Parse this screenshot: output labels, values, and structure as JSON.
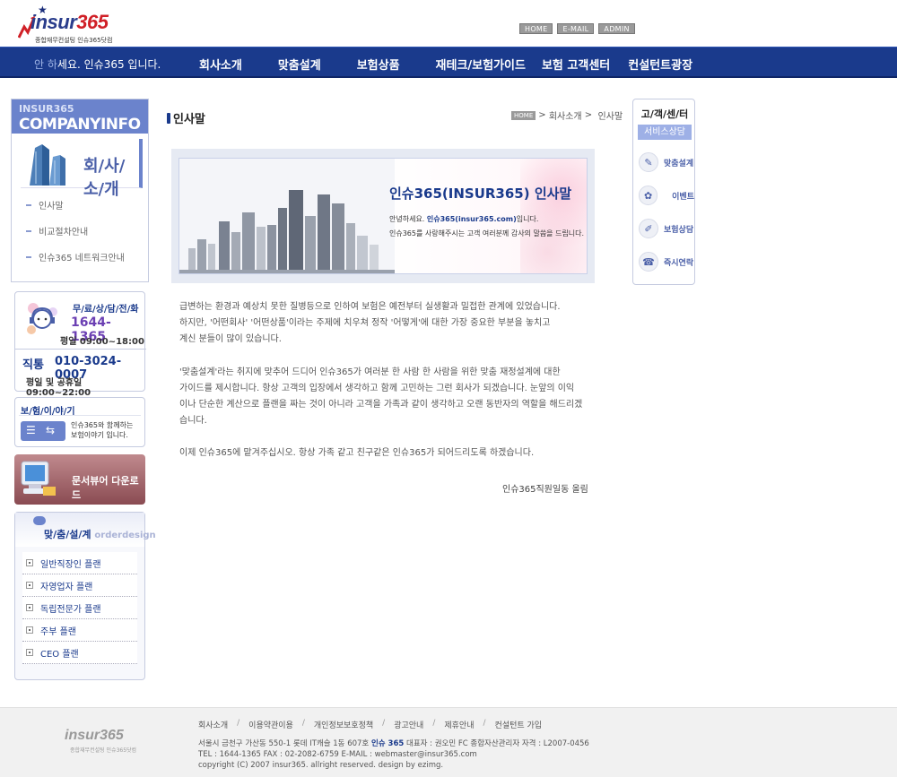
{
  "header": {
    "logo_text_part1": "insur",
    "logo_text_part2": "365",
    "logo_tagline": "종합재무컨설팅 인슈365닷컴",
    "top_buttons": [
      "HOME",
      "E-MAIL",
      "ADMIN"
    ]
  },
  "nav": {
    "greeting_fade": "안 하",
    "greeting": "세요. 인슈365 입니다.",
    "menu": [
      "회사소개",
      "맞춤설계",
      "보험상품",
      "재테크/보험가이드",
      "보험 고객센터",
      "컨설턴트광장"
    ]
  },
  "sidebar": {
    "company_small": "INSUR365",
    "company_big": "COMPANYINFO",
    "company_title": "회/사/소/개",
    "menu": [
      "인사말",
      "비교절차안내",
      "인슈365 네트워크안내"
    ],
    "call": {
      "label": "무/료/상/담/전/화",
      "number": "1644-1365",
      "hours": "평일 09:00~18:00",
      "direct_label": "직통",
      "direct_number": "010-3024-0007",
      "direct_hours": "평일 및 공휴일 09:00~22:00"
    },
    "story": {
      "title": "보/험/이/야/기",
      "text_line1": "인슈365와 함께하는",
      "text_line2": "보험이야기 입니다."
    },
    "viewer_label": "문서뷰어 다운로드",
    "design": {
      "title": "맞/춤/설/계",
      "subtitle": "orderdesign",
      "items": [
        "일반직장인 플랜",
        "자영업자 플랜",
        "독립전문가 플랜",
        "주부 플랜",
        "CEO 플랜"
      ]
    }
  },
  "content": {
    "heading": "인사말",
    "breadcrumb": {
      "home": "HOME",
      "level1": "회사소개",
      "level2": "인사말"
    },
    "banner": {
      "title": "인슈365(INSUR365) 인사말",
      "line1_pre": "안녕하세요. ",
      "line1_bold": "인슈365(insur365.com)",
      "line1_post": "입니다.",
      "line2": "인슈365를 사랑해주시는 고객 여러분께 감사의 말씀을 드립니다."
    },
    "paragraphs": [
      [
        "급변하는 환경과 예상치 못한 질병등으로 인하여 보험은 예전부터 실생활과 밀접한 관계에 있었습니다.",
        "하지만, '어떤회사' '어떤상품'이라는 주제에 치우쳐 정작 '어떻게'에 대한 가장 중요한 부분을 놓치고",
        "계신 분들이 많이 있습니다."
      ],
      [
        "'맞춤설계'라는 취지에 맞추어 드디어 인슈365가 여러분 한 사람 한 사람을 위한 맞춤 재정설계에 대한",
        "가이드를 제시합니다. 항상 고객의 입장에서 생각하고 함께 고민하는 그런 회사가 되겠습니다. 눈앞의 이익",
        "이나 단순한 계산으로 플랜을 짜는 것이 아니라 고객을 가족과 같이 생각하고 오랜 동반자의 역할을 해드리겠",
        "습니다."
      ],
      [
        "이제 인슈365에 맡겨주십시오. 항상 가족 같고 친구같은 인슈365가 되어드리도록 하겠습니다."
      ]
    ],
    "signature": "인슈365직원일동 올림"
  },
  "rightbar": {
    "title": "고/객/센/터",
    "subtitle": "서비스상담",
    "items": [
      "맞춤설계",
      "이벤트",
      "보험상담",
      "즉시연락"
    ]
  },
  "footer": {
    "logo_text": "insur365",
    "logo_tagline": "종합재무컨설팅 인슈365닷컴",
    "links": [
      "회사소개",
      "이용약관이용",
      "개인정보보호정책",
      "광고안내",
      "제휴안내",
      "컨설턴트 가입"
    ],
    "addr_pre": "서울시 금천구 가산동 550-1 롯데 IT캐슬 1동 607호 ",
    "addr_bold": "인슈 365",
    "addr_post": " 대표자 : 권오민 FC 종합자산관리자 자격 : L2007-0456",
    "contact": "TEL : 1644-1365 FAX : 02-2082-6759 E-MAIL : webmaster@insur365.com",
    "copyright": "copyright (C) 2007 insur365. allright reserved. design by ezimg."
  },
  "colors": {
    "nav_bg": "#1a3a8c",
    "accent": "#6b83cc",
    "brand_red": "#d02027"
  }
}
